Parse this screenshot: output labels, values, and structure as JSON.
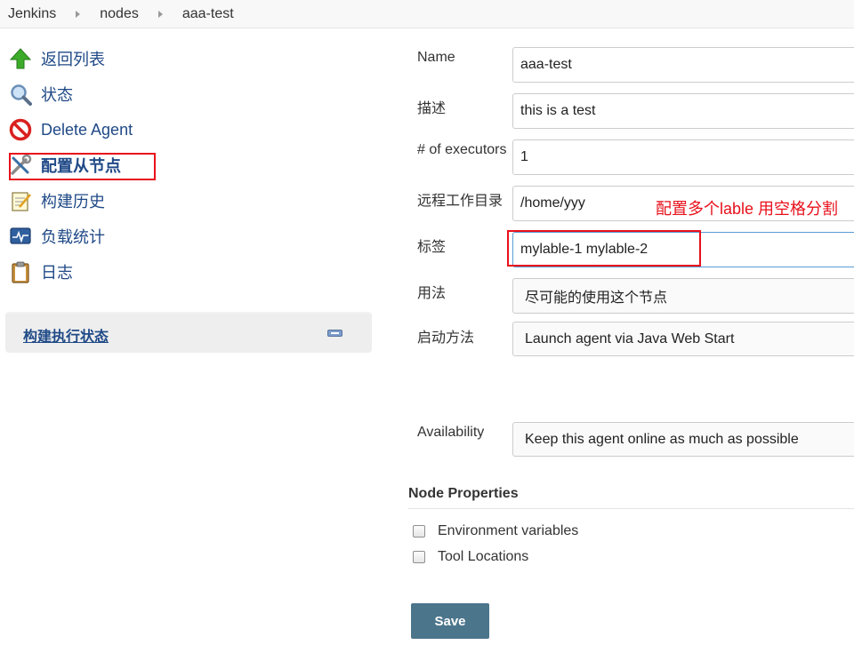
{
  "breadcrumb": {
    "items": [
      "Jenkins",
      "nodes",
      "aaa-test"
    ]
  },
  "sidebar": {
    "tasks": [
      {
        "label": "返回列表",
        "icon": "up-arrow-icon"
      },
      {
        "label": "状态",
        "icon": "magnifier-icon"
      },
      {
        "label": "Delete Agent",
        "icon": "no-entry-icon"
      },
      {
        "label": "配置从节点",
        "icon": "wrench-screwdriver-icon",
        "active": true
      },
      {
        "label": "构建历史",
        "icon": "notepad-icon"
      },
      {
        "label": "负载统计",
        "icon": "monitor-graph-icon"
      },
      {
        "label": "日志",
        "icon": "clipboard-icon"
      }
    ],
    "executors_title": "构建执行状态"
  },
  "form": {
    "name": {
      "label": "Name",
      "value": "aaa-test"
    },
    "description": {
      "label": "描述",
      "value": "this is a test"
    },
    "executors": {
      "label": "# of executors",
      "value": "1"
    },
    "remote_root": {
      "label": "远程工作目录",
      "value": "/home/yyy"
    },
    "labels": {
      "label": "标签",
      "value": "mylable-1 mylable-2"
    },
    "usage": {
      "label": "用法",
      "value": "尽可能的使用这个节点"
    },
    "launch": {
      "label": "启动方法",
      "value": "Launch agent via Java Web Start"
    },
    "availability": {
      "label": "Availability",
      "value": "Keep this agent online as much as possible"
    },
    "annotation": "配置多个lable 用空格分割"
  },
  "node_properties": {
    "title": "Node Properties",
    "options": [
      "Environment variables",
      "Tool Locations"
    ]
  },
  "save_label": "Save",
  "colors": {
    "link": "#204a87",
    "highlight_red": "#e8101b",
    "save_button": "#4b758b"
  }
}
